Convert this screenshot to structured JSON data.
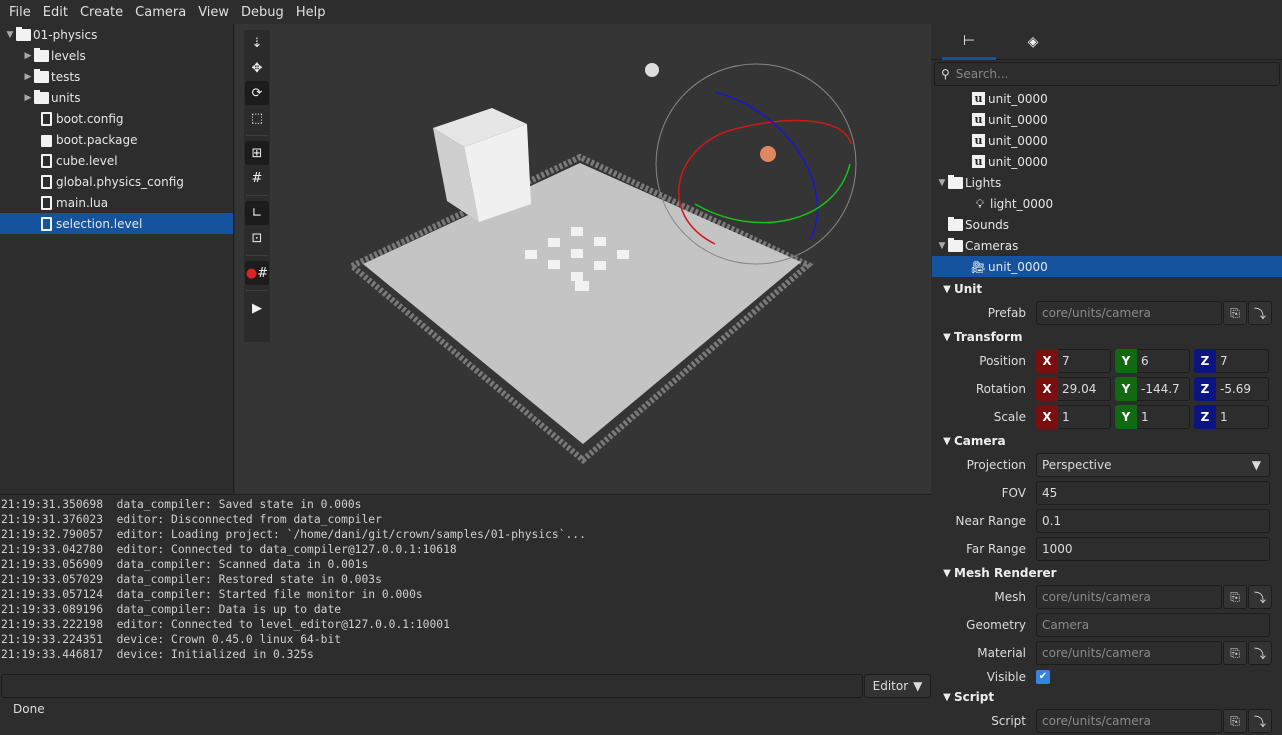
{
  "menu": [
    "File",
    "Edit",
    "Create",
    "Camera",
    "View",
    "Debug",
    "Help"
  ],
  "project": {
    "root": "01-physics",
    "folders": [
      "levels",
      "tests",
      "units"
    ],
    "files": [
      {
        "name": "boot.config",
        "icon": "file-icon"
      },
      {
        "name": "boot.package",
        "icon": "package-icon"
      },
      {
        "name": "cube.level",
        "icon": "file-icon"
      },
      {
        "name": "global.physics_config",
        "icon": "file-icon"
      },
      {
        "name": "main.lua",
        "icon": "script-icon"
      },
      {
        "name": "selection.level",
        "icon": "file-icon",
        "selected": true
      }
    ]
  },
  "toolbar": [
    "place-tool",
    "move-tool",
    "rotate-tool",
    "scale-tool",
    "snap-to-grid",
    "grid",
    "reference-world",
    "reference-local",
    "snap-magnet",
    "play"
  ],
  "console": {
    "lines": [
      "21:19:31.350698  data_compiler: Saved state in 0.000s",
      "21:19:31.376023  editor: Disconnected from data_compiler",
      "21:19:32.790057  editor: Loading project: `/home/dani/git/crown/samples/01-physics`...",
      "21:19:33.042780  editor: Connected to data_compiler@127.0.0.1:10618",
      "21:19:33.056909  data_compiler: Scanned data in 0.001s",
      "21:19:33.057029  data_compiler: Restored state in 0.003s",
      "21:19:33.057124  data_compiler: Started file monitor in 0.000s",
      "21:19:33.089196  data_compiler: Data is up to date",
      "21:19:33.222198  editor: Connected to level_editor@127.0.0.1:10001",
      "21:19:33.224351  device: Crown 0.45.0 linux 64-bit",
      "21:19:33.446817  device: Initialized in 0.325s"
    ],
    "input": "",
    "target": "Editor"
  },
  "status": "Done",
  "scene": {
    "search_placeholder": "Search...",
    "units": [
      "unit_0000",
      "unit_0000",
      "unit_0000",
      "unit_0000"
    ],
    "lights_label": "Lights",
    "light": "light_0000",
    "sounds_label": "Sounds",
    "cameras_label": "Cameras",
    "camera": "unit_0000"
  },
  "props": {
    "unit": {
      "title": "Unit",
      "prefab_label": "Prefab",
      "prefab": "core/units/camera"
    },
    "transform": {
      "title": "Transform",
      "position_label": "Position",
      "position": [
        "7",
        "6",
        "7"
      ],
      "rotation_label": "Rotation",
      "rotation": [
        "29.04",
        "-144.7",
        "-5.69"
      ],
      "scale_label": "Scale",
      "scale": [
        "1",
        "1",
        "1"
      ]
    },
    "camera": {
      "title": "Camera",
      "projection_label": "Projection",
      "projection": "Perspective",
      "fov_label": "FOV",
      "fov": "45",
      "near_label": "Near Range",
      "near": "0.1",
      "far_label": "Far Range",
      "far": "1000"
    },
    "mesh": {
      "title": "Mesh Renderer",
      "mesh_label": "Mesh",
      "mesh": "core/units/camera",
      "geometry_label": "Geometry",
      "geometry": "Camera",
      "material_label": "Material",
      "material": "core/units/camera",
      "visible_label": "Visible",
      "visible": true
    },
    "script": {
      "title": "Script",
      "script_label": "Script",
      "script": "core/units/camera"
    }
  },
  "colors": {
    "selection": "#15539e",
    "x": "#7a0f0f",
    "y": "#116911",
    "z": "#0c1480"
  }
}
